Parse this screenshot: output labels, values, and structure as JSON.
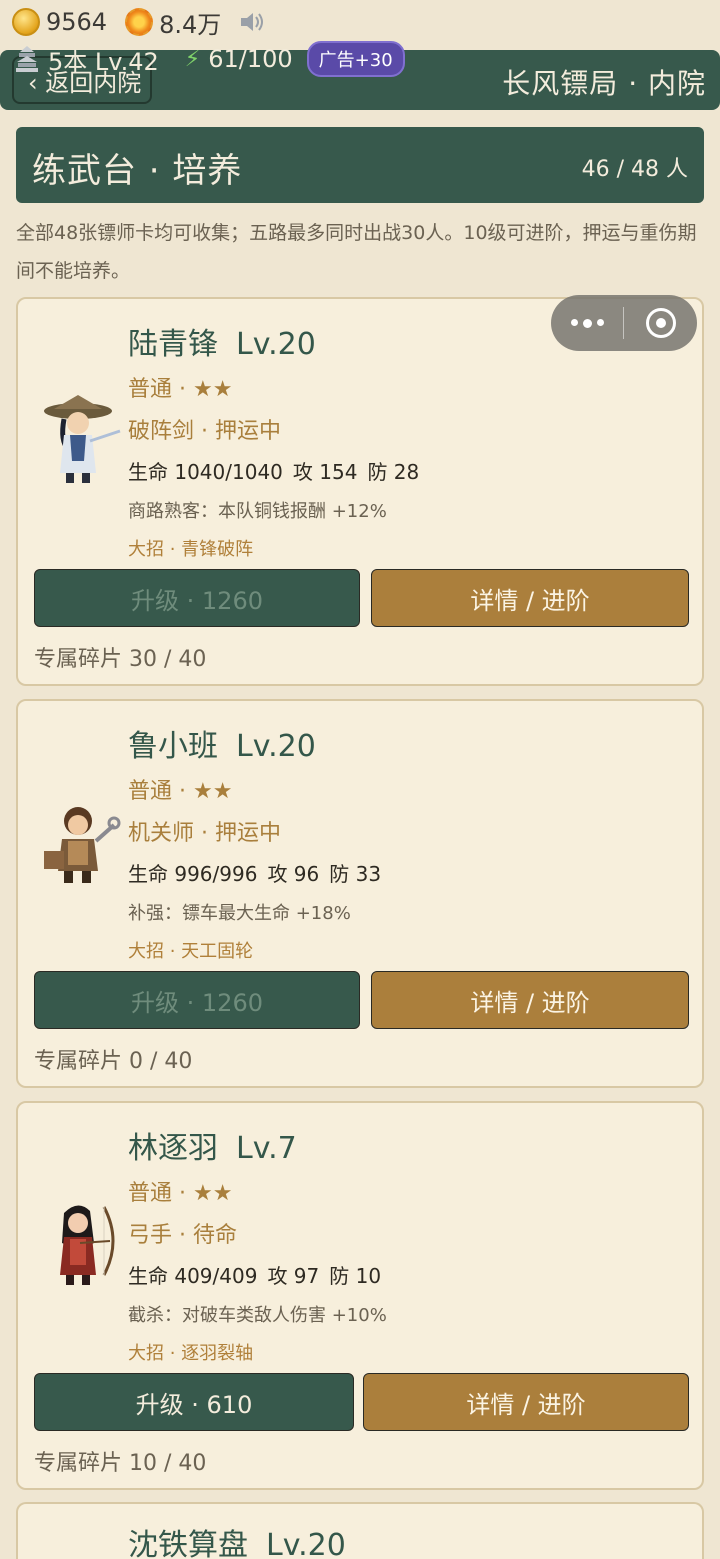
{
  "status": {
    "coins": "9564",
    "wealth": "8.4万",
    "icons": {
      "coin": "coin-icon",
      "wealth": "flower-coin-icon",
      "sound": "speaker-icon"
    }
  },
  "topbar": {
    "back_label": "‹ 返回内院",
    "title": "长风镖局 · 内院",
    "base_level": "5本 Lv.42",
    "energy": "61/100",
    "ad_label": "广告+30"
  },
  "header": {
    "title": "练武台 · 培养",
    "count": "46 / 48 人"
  },
  "notice": "全部48张镖师卡均可收集；五路最多同时出战30人。10级可进阶，押运与重伤期间不能培养。",
  "cards": [
    {
      "name": "陆青锋",
      "level": "Lv.20",
      "rarity": "普通 · ★★",
      "role": "破阵剑 · 押运中",
      "hp": "生命 1040/1040",
      "atk": "攻 154",
      "def": "防 28",
      "passive": "商路熟客：本队铜钱报酬 +12%",
      "ultimate": "大招 · 青锋破阵",
      "upgrade_label": "升级 · 1260",
      "upgrade_enabled": false,
      "detail_label": "详情 / 进阶",
      "shards": "专属碎片 30 / 40"
    },
    {
      "name": "鲁小班",
      "level": "Lv.20",
      "rarity": "普通 · ★★",
      "role": "机关师 · 押运中",
      "hp": "生命 996/996",
      "atk": "攻 96",
      "def": "防 33",
      "passive": "补强：镖车最大生命 +18%",
      "ultimate": "大招 · 天工固轮",
      "upgrade_label": "升级 · 1260",
      "upgrade_enabled": false,
      "detail_label": "详情 / 进阶",
      "shards": "专属碎片 0 / 40"
    },
    {
      "name": "林逐羽",
      "level": "Lv.7",
      "rarity": "普通 · ★★",
      "role": "弓手 · 待命",
      "hp": "生命 409/409",
      "atk": "攻 97",
      "def": "防 10",
      "passive": "截杀：对破车类敌人伤害 +10%",
      "ultimate": "大招 · 逐羽裂轴",
      "upgrade_label": "升级 · 610",
      "upgrade_enabled": true,
      "detail_label": "详情 / 进阶",
      "shards": "专属碎片 10 / 40"
    },
    {
      "name": "沈铁算盘",
      "level": "Lv.20"
    }
  ],
  "colors": {
    "background": "#efe6d2",
    "primary_green": "#37594c",
    "accent_gold": "#ab7f3c",
    "card_bg": "#f7efdc"
  }
}
